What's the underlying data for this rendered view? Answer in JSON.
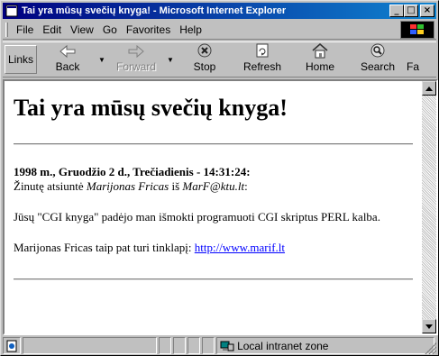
{
  "window": {
    "title": "Tai yra mūsų svečių knyga! - Microsoft Internet Explorer"
  },
  "menu": {
    "items": [
      "File",
      "Edit",
      "View",
      "Go",
      "Favorites",
      "Help"
    ]
  },
  "toolbar": {
    "links_label": "Links",
    "back_label": "Back",
    "forward_label": "Forward",
    "stop_label": "Stop",
    "refresh_label": "Refresh",
    "home_label": "Home",
    "search_label": "Search",
    "favorites_label": "Fa"
  },
  "page": {
    "heading": "Tai yra mūsų svečių knyga!",
    "entry_date": "1998 m., Gruodžio 2 d., Trečiadienis - 14:31:24:",
    "sent_by_prefix": "Žinutę atsiuntė",
    "sender_name": "Marijonas Fricas",
    "sent_by_mid": "iš",
    "sender_email": "MarF@ktu.lt",
    "sent_by_suffix": ":",
    "message": "Jūsų \"CGI knyga\" padėjo man išmokti programuoti CGI skriptus PERL kalba.",
    "homepage_prefix": "Marijonas Fricas taip pat turi tinklapį:",
    "homepage_url": "http://www.marif.lt"
  },
  "status": {
    "zone": "Local intranet zone"
  },
  "colors": {
    "titlebar": "#000080",
    "link": "#0000ff"
  }
}
